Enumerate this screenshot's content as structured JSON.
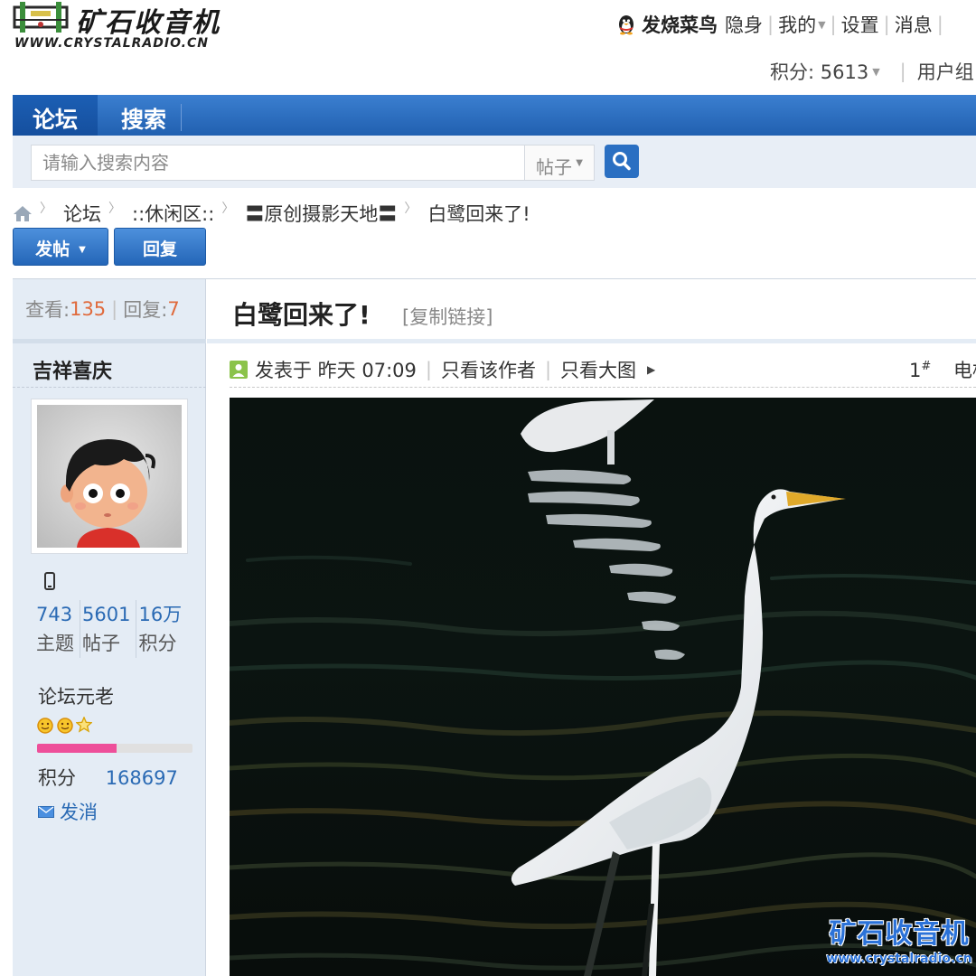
{
  "site": {
    "logo_text": "矿石收音机",
    "logo_url": "WWW.CRYSTALRADIO.CN"
  },
  "user_nav": {
    "username": "发烧菜鸟",
    "items": [
      "隐身",
      "我的",
      "设置",
      "消息"
    ],
    "points_label": "积分: 5613",
    "usergroup_label": "用户组"
  },
  "nav": {
    "tabs": [
      "论坛",
      "搜索"
    ]
  },
  "search": {
    "placeholder": "请输入搜索内容",
    "type": "帖子"
  },
  "breadcrumb": [
    "论坛",
    "::休闲区::",
    "〓原创摄影天地〓",
    "白鹭回来了!"
  ],
  "actions": {
    "post": "发帖",
    "reply": "回复"
  },
  "thread": {
    "views_label": "查看:",
    "views": "135",
    "replies_label": "回复:",
    "replies": "7",
    "title": "白鹭回来了!",
    "copy_link": "[复制链接]"
  },
  "author": {
    "name": "吉祥喜庆",
    "stats": [
      {
        "value": "743",
        "label": "主题"
      },
      {
        "value": "5601",
        "label": "帖子"
      },
      {
        "value": "16万",
        "label": "积分"
      }
    ],
    "rank": "论坛元老",
    "level_fraction": 0.51,
    "points_label": "积分",
    "points": "168697",
    "send_message": "发消"
  },
  "post": {
    "posted_at": "发表于 昨天 07:09",
    "only_author": "只看该作者",
    "only_images": "只看大图",
    "floor": "1",
    "floor_mark": "#",
    "floor_extra": "电梯"
  },
  "watermark": {
    "main": "矿石收音机",
    "url": "www.crystalradio.cn"
  },
  "colors": {
    "nav_blue": "#2160b0",
    "link_blue": "#2a6ab4",
    "count_orange": "#e06a3c",
    "level_pink": "#ee4f9a",
    "sidebar_bg": "#e4ecf5"
  }
}
